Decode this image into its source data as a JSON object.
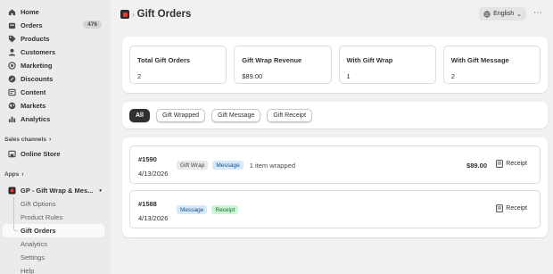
{
  "sidebar": {
    "nav": [
      {
        "label": "Home",
        "icon": "home-icon"
      },
      {
        "label": "Orders",
        "icon": "orders-icon",
        "badge": "476"
      },
      {
        "label": "Products",
        "icon": "tag-icon"
      },
      {
        "label": "Customers",
        "icon": "person-icon"
      },
      {
        "label": "Marketing",
        "icon": "target-icon"
      },
      {
        "label": "Discounts",
        "icon": "discount-icon"
      },
      {
        "label": "Content",
        "icon": "content-icon"
      },
      {
        "label": "Markets",
        "icon": "globe-icon"
      },
      {
        "label": "Analytics",
        "icon": "chart-icon"
      }
    ],
    "sales_channels_label": "Sales channels",
    "online_store_label": "Online Store",
    "apps_label": "Apps",
    "app_name": "GP - Gift Wrap & Mes...",
    "app_sub": [
      "Gift Options",
      "Product Rules",
      "Gift Orders",
      "Analytics",
      "Settings",
      "Help"
    ]
  },
  "header": {
    "title": "Gift Orders",
    "language": "English",
    "more": "⋯"
  },
  "stats": [
    {
      "label": "Total Gift Orders",
      "value": "2"
    },
    {
      "label": "Gift Wrap Revenue",
      "value": "$89.00"
    },
    {
      "label": "With Gift Wrap",
      "value": "1"
    },
    {
      "label": "With Gift Message",
      "value": "2"
    }
  ],
  "filters": [
    "All",
    "Gift Wrapped",
    "Gift Message",
    "Gift Receipt"
  ],
  "orders": [
    {
      "number": "#1590",
      "date": "4/13/2026",
      "tags": [
        "Gift Wrap",
        "Message"
      ],
      "note": "1 item wrapped",
      "amount": "$89.00",
      "receipt_label": "Receipt"
    },
    {
      "number": "#1588",
      "date": "4/13/2026",
      "tags": [
        "Message",
        "Receipt"
      ],
      "note": "",
      "amount": "",
      "receipt_label": "Receipt"
    }
  ],
  "colors": {
    "accent": "#303030",
    "sidebar_bg": "#ebebeb",
    "page_bg": "#f1f1f1",
    "app_logo": "#e23b3b"
  }
}
